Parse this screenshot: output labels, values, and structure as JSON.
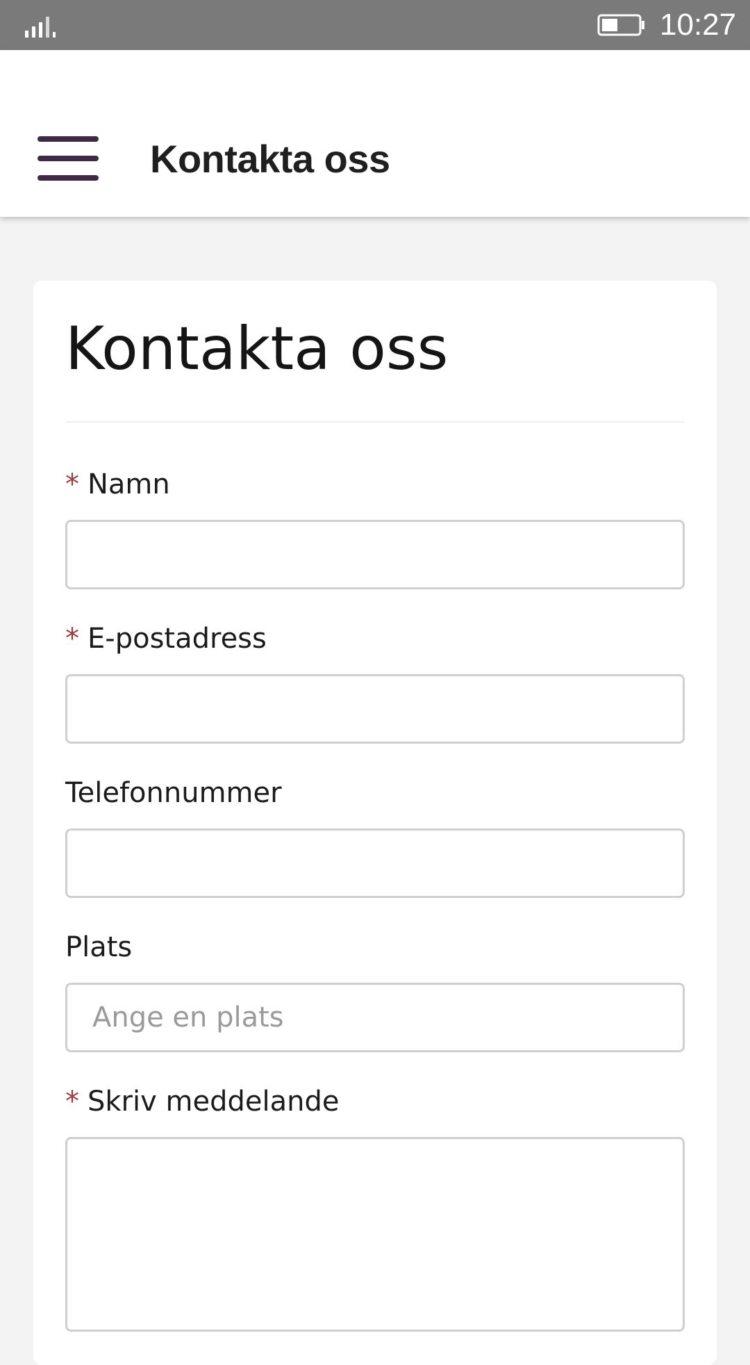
{
  "status_bar": {
    "time": "10:27",
    "signal_icon": "signal-bars-icon",
    "battery_icon": "battery-icon"
  },
  "app_bar": {
    "menu_icon": "hamburger-menu-icon",
    "title": "Kontakta oss"
  },
  "form": {
    "heading": "Kontakta oss",
    "required_marker": "*",
    "fields": {
      "name": {
        "label": "Namn",
        "required": true,
        "value": ""
      },
      "email": {
        "label": "E-postadress",
        "required": true,
        "value": ""
      },
      "phone": {
        "label": "Telefonnummer",
        "required": false,
        "value": ""
      },
      "location": {
        "label": "Plats",
        "required": false,
        "value": "",
        "placeholder": "Ange en plats"
      },
      "message": {
        "label": "Skriv meddelande",
        "required": true,
        "value": ""
      }
    }
  },
  "colors": {
    "status_bar": "#7a7a7a",
    "menu_icon": "#3e2a44",
    "required_star": "#9b3b3b",
    "background": "#f3f3f3"
  }
}
